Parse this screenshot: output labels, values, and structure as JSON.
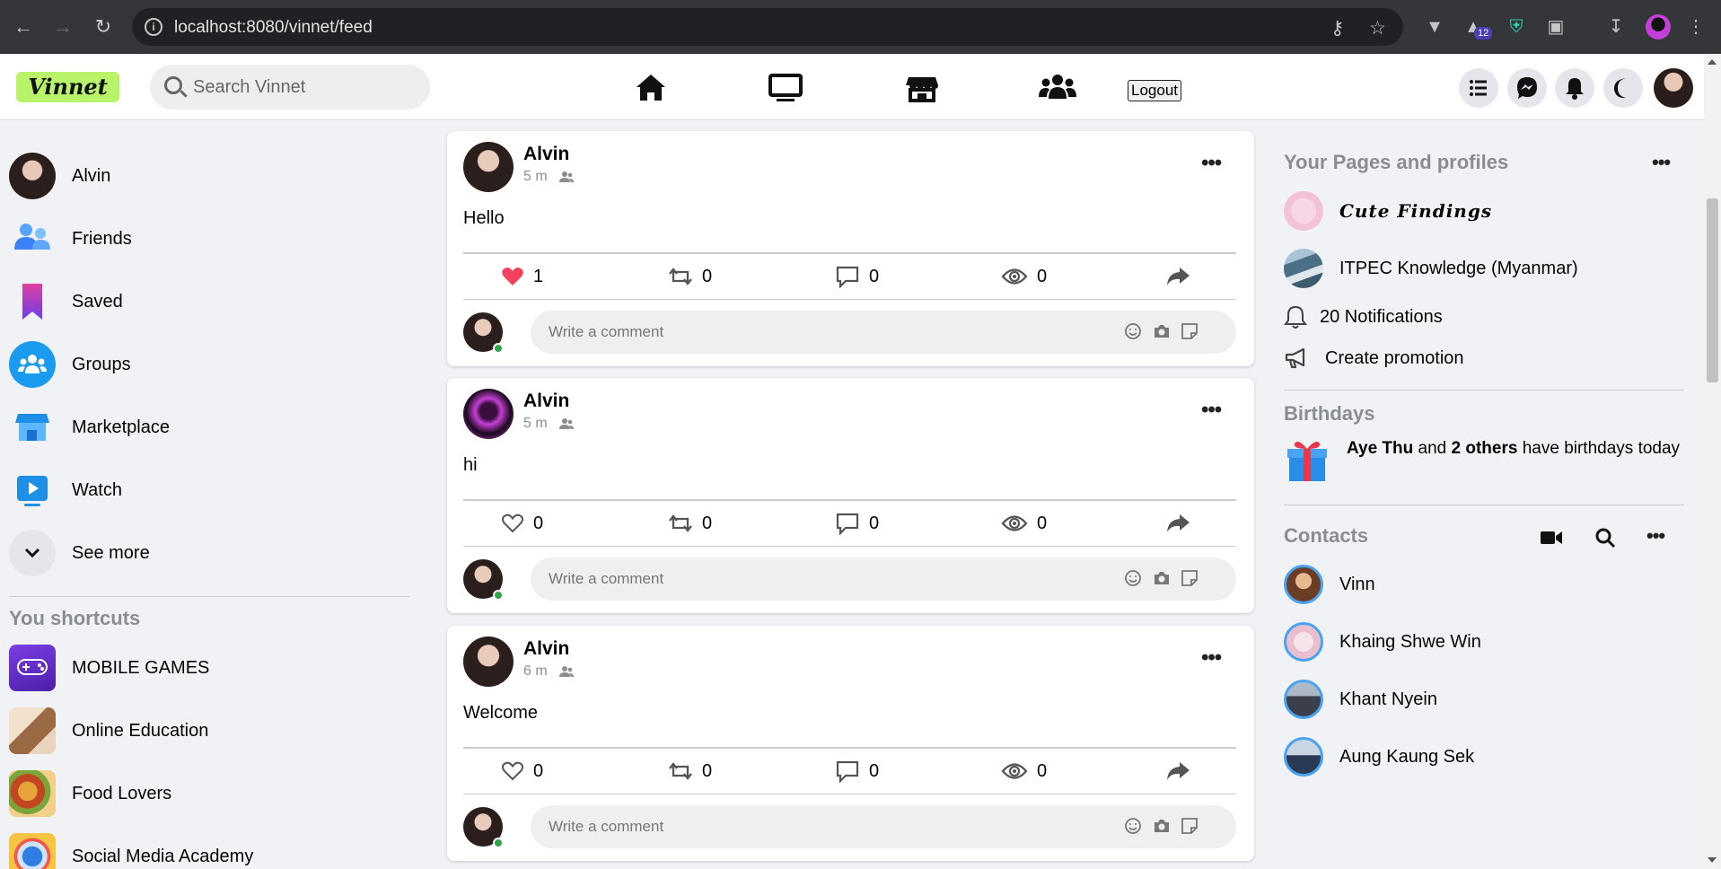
{
  "browser": {
    "url": "localhost:8080/vinnet/feed",
    "extension_badge": "12"
  },
  "header": {
    "logo": "Vinnet",
    "search_placeholder": "Search Vinnet",
    "logout_label": "Logout",
    "nav_icons": [
      "home-icon",
      "watch-icon",
      "marketplace-icon",
      "groups-icon"
    ],
    "right_icons": [
      "menu-icon",
      "messenger-icon",
      "bell-icon",
      "moon-icon"
    ]
  },
  "left_sidebar": {
    "items": [
      {
        "label": "Alvin",
        "icon": "avatar"
      },
      {
        "label": "Friends",
        "icon": "friends-icon"
      },
      {
        "label": "Saved",
        "icon": "bookmark-icon"
      },
      {
        "label": "Groups",
        "icon": "groups-icon"
      },
      {
        "label": "Marketplace",
        "icon": "store-icon"
      },
      {
        "label": "Watch",
        "icon": "play-icon"
      },
      {
        "label": "See more",
        "icon": "chevron-down-icon"
      }
    ],
    "shortcuts_title": "You shortcuts",
    "shortcuts": [
      {
        "label": "MOBILE GAMES"
      },
      {
        "label": "Online Education"
      },
      {
        "label": "Food Lovers"
      },
      {
        "label": "Social Media Academy"
      }
    ]
  },
  "posts": [
    {
      "author": "Alvin",
      "time": "5 m",
      "text": "Hello",
      "likes": "1",
      "liked": true,
      "reposts": "0",
      "comments": "0",
      "views": "0",
      "comment_placeholder": "Write a comment"
    },
    {
      "author": "Alvin",
      "time": "5 m",
      "text": "hi",
      "likes": "0",
      "liked": false,
      "reposts": "0",
      "comments": "0",
      "views": "0",
      "comment_placeholder": "Write a comment"
    },
    {
      "author": "Alvin",
      "time": "6 m",
      "text": "Welcome",
      "likes": "0",
      "liked": false,
      "reposts": "0",
      "comments": "0",
      "views": "0",
      "comment_placeholder": "Write a comment"
    }
  ],
  "right_sidebar": {
    "pages_title": "Your Pages and profiles",
    "pages": [
      {
        "label": "Cute Findings"
      },
      {
        "label": "ITPEC Knowledge (Myanmar)"
      }
    ],
    "notifications_label": "20 Notifications",
    "promotion_label": "Create promotion",
    "birthdays_title": "Birthdays",
    "birthday": {
      "name": "Aye Thu",
      "joiner": " and ",
      "others": "2 others",
      "suffix": " have birthdays today"
    },
    "contacts_title": "Contacts",
    "contacts": [
      {
        "name": "Vinn"
      },
      {
        "name": "Khaing Shwe Win"
      },
      {
        "name": "Khant Nyein"
      },
      {
        "name": "Aung Kaung Sek"
      }
    ]
  },
  "colors": {
    "like_red": "#f3425f",
    "logo_green": "#b8f36a",
    "online_green": "#31a24c"
  }
}
